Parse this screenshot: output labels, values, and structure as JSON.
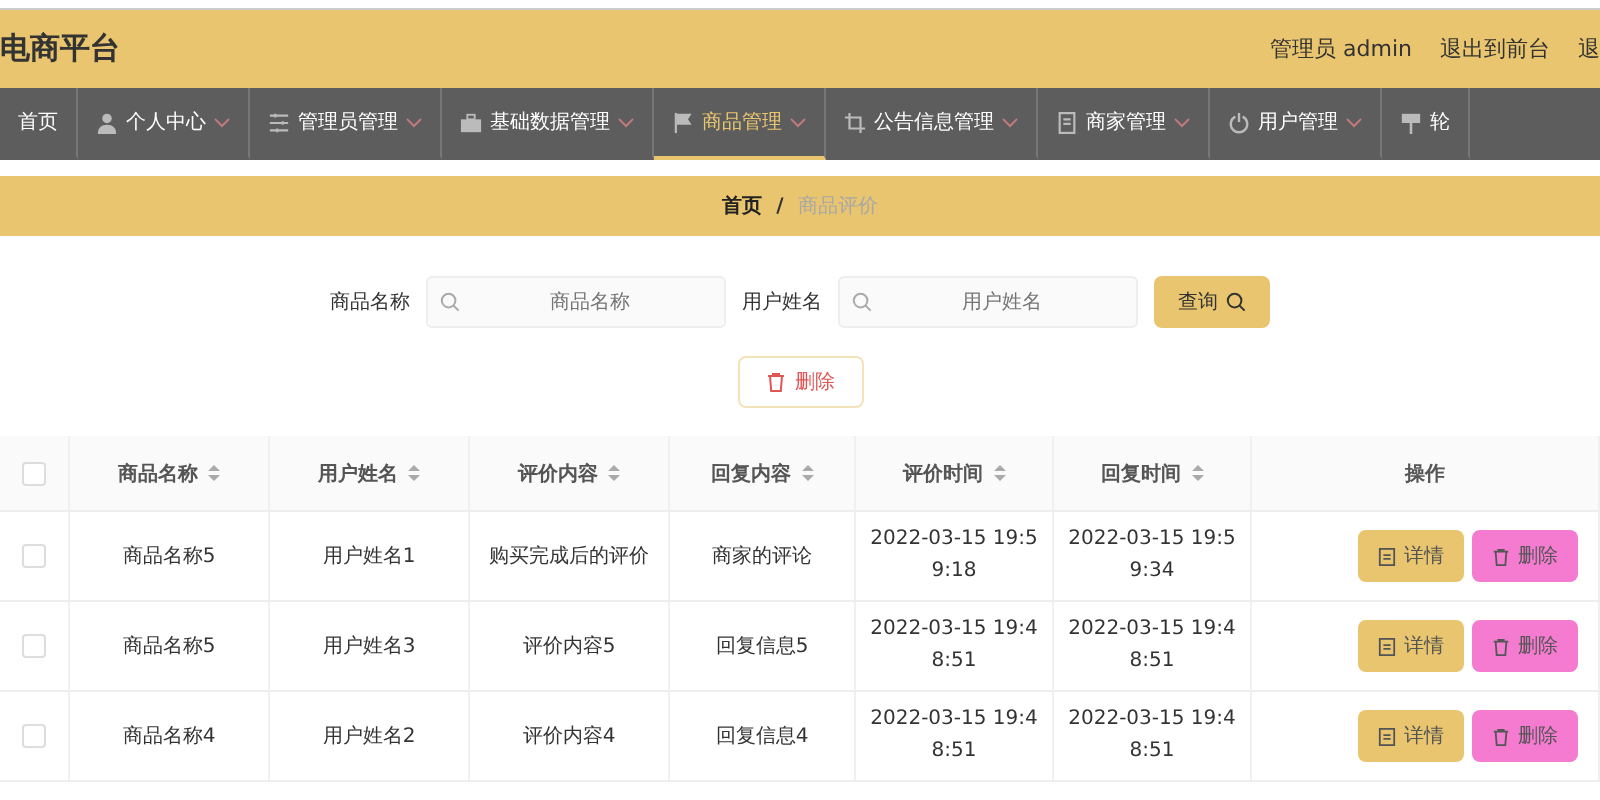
{
  "header": {
    "title": "电商平台",
    "user_label": "管理员 admin",
    "links": [
      "退出到前台",
      "退"
    ]
  },
  "nav": [
    {
      "label": "首页",
      "selected": false,
      "dropdown": false
    },
    {
      "label": "个人中心",
      "selected": false,
      "dropdown": true
    },
    {
      "label": "管理员管理",
      "selected": false,
      "dropdown": true
    },
    {
      "label": "基础数据管理",
      "selected": false,
      "dropdown": true
    },
    {
      "label": "商品管理",
      "selected": true,
      "dropdown": true
    },
    {
      "label": "公告信息管理",
      "selected": false,
      "dropdown": true
    },
    {
      "label": "商家管理",
      "selected": false,
      "dropdown": true
    },
    {
      "label": "用户管理",
      "selected": false,
      "dropdown": true
    },
    {
      "label": "轮",
      "selected": false,
      "dropdown": false
    }
  ],
  "breadcrumb": {
    "home": "首页",
    "separator": "/",
    "current": "商品评价"
  },
  "search": {
    "fields": [
      {
        "label": "商品名称",
        "placeholder": "商品名称"
      },
      {
        "label": "用户姓名",
        "placeholder": "用户姓名"
      }
    ],
    "button": "查询"
  },
  "delete_button": "删除",
  "table": {
    "all_checked": false,
    "columns": [
      {
        "label": "商品名称",
        "sortable": true
      },
      {
        "label": "用户姓名",
        "sortable": true
      },
      {
        "label": "评价内容",
        "sortable": true
      },
      {
        "label": "回复内容",
        "sortable": true
      },
      {
        "label": "评价时间",
        "sortable": true
      },
      {
        "label": "回复时间",
        "sortable": true
      },
      {
        "label": "操作",
        "sortable": false
      }
    ],
    "rows": [
      {
        "checked": false,
        "cells": [
          "商品名称5",
          "用户姓名1",
          "购买完成后的评价",
          "商家的评论",
          "2022-03-15 19:59:18",
          "2022-03-15 19:59:34"
        ],
        "actions": [
          "详情",
          "删除"
        ]
      },
      {
        "checked": false,
        "cells": [
          "商品名称5",
          "用户姓名3",
          "评价内容5",
          "回复信息5",
          "2022-03-15 19:48:51",
          "2022-03-15 19:48:51"
        ],
        "actions": [
          "详情",
          "删除"
        ]
      },
      {
        "checked": false,
        "cells": [
          "商品名称4",
          "用户姓名2",
          "评价内容4",
          "回复信息4",
          "2022-03-15 19:48:51",
          "2022-03-15 19:48:51"
        ],
        "actions": [
          "详情",
          "删除"
        ]
      }
    ]
  }
}
